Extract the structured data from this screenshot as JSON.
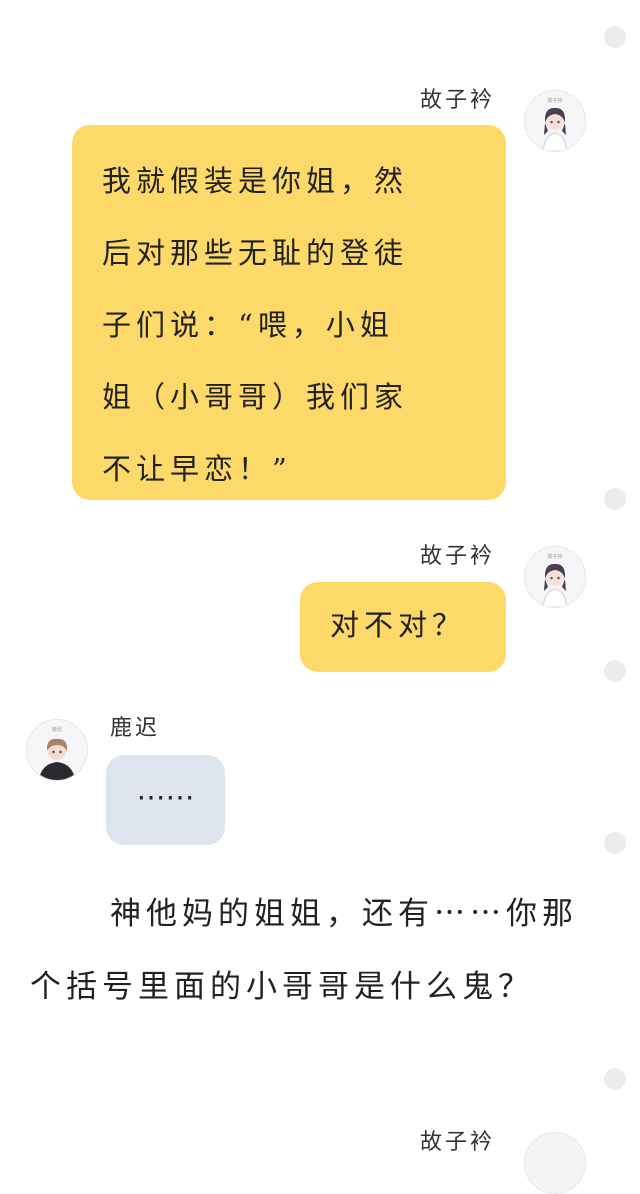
{
  "colors": {
    "background": "#ffffff",
    "bubble_yellow": "#fcd968",
    "bubble_grey": "#dde4ee",
    "scroll_dot": "#ececec"
  },
  "messages": [
    {
      "sender": "故子衿",
      "side": "right",
      "avatar_icon": "anime-girl-avatar",
      "avatar_caption": "故子衿",
      "text": "我就假装是你姐，然\n后对那些无耻的登徒\n子们说：“喂，小姐\n姐（小哥哥）我们家\n不让早恋！”"
    },
    {
      "sender": "故子衿",
      "side": "right",
      "avatar_icon": "anime-girl-avatar",
      "avatar_caption": "故子衿",
      "text": "对不对？"
    },
    {
      "sender": "鹿迟",
      "side": "left",
      "avatar_icon": "anime-boy-avatar",
      "avatar_caption": "鹿迟",
      "text": "⋯⋯"
    }
  ],
  "narration": "神他妈的姐姐，还有⋯⋯你那个括号里面的小哥哥是什么鬼？",
  "next_sender": "故子衿"
}
